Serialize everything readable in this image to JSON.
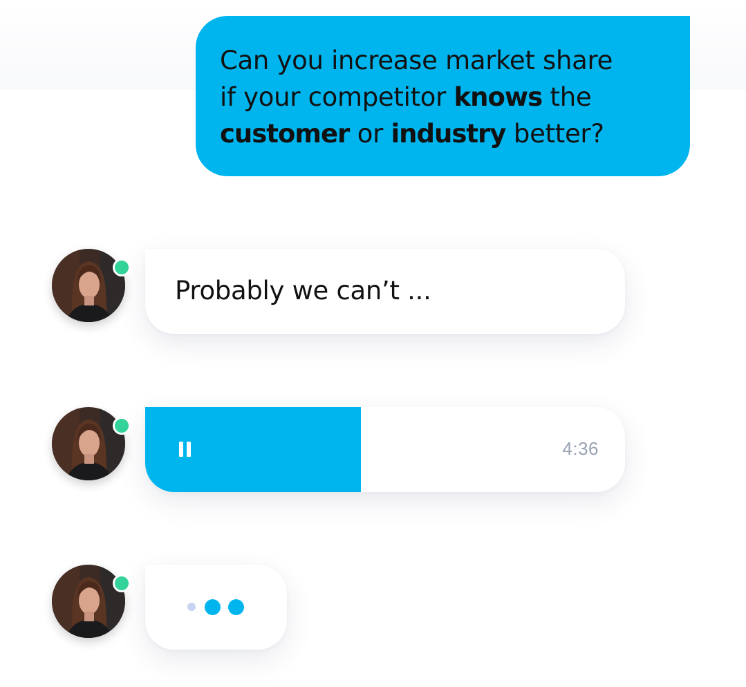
{
  "question": {
    "line1": "Can you increase market share",
    "line2_pre": "if your competitor ",
    "line2_bold": "knows",
    "line2_post": " the",
    "line3_bold1": "customer",
    "line3_mid": " or ",
    "line3_bold2": "industry",
    "line3_post": " better?"
  },
  "reply": {
    "text": "Probably we can’t ..."
  },
  "voice_message": {
    "duration": "4:36",
    "progress": 0.45,
    "state": "playing",
    "control_icon": "pause-icon"
  },
  "typing_indicator": {
    "dot_count": 3
  },
  "colors": {
    "accent": "#00b5ee",
    "online": "#34d399",
    "time_text": "#9aa3b4",
    "typing_faded": "#c9d3f2"
  },
  "contact": {
    "status": "online"
  }
}
